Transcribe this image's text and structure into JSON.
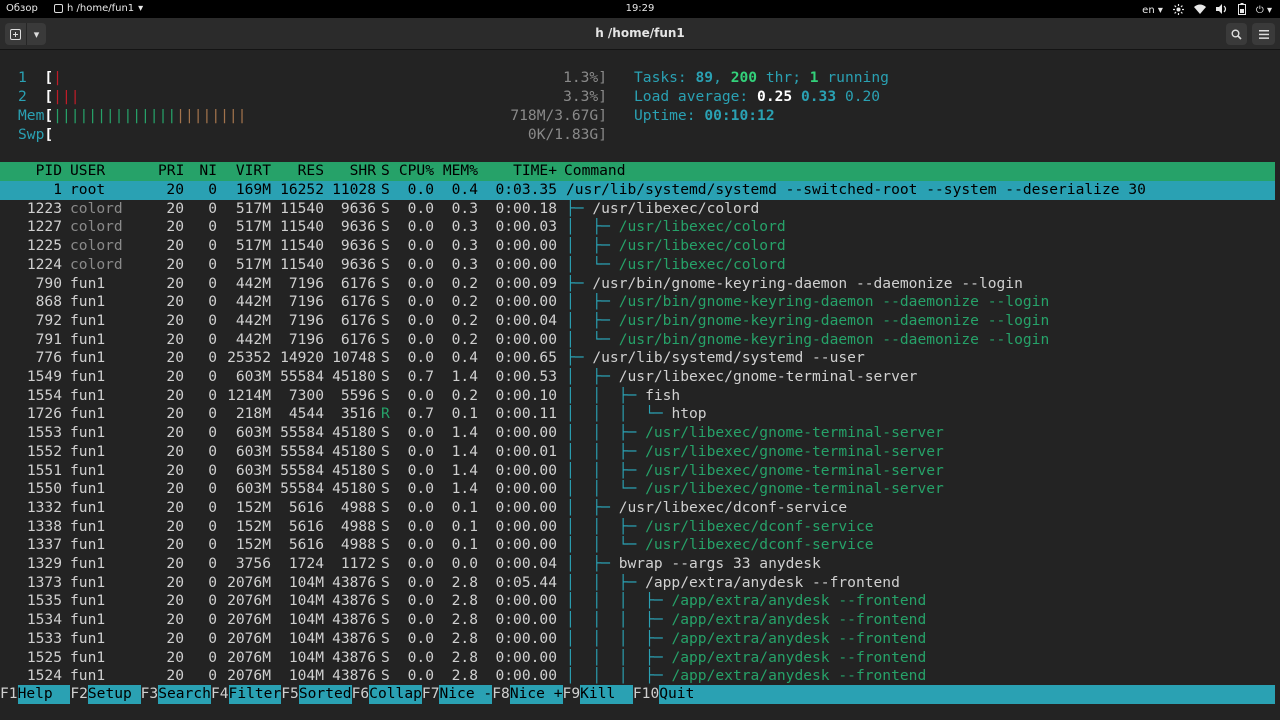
{
  "topbar": {
    "activities": "Обзор",
    "app_name": "h /home/fun1",
    "clock": "19:29",
    "lang": "en"
  },
  "window": {
    "title": "h /home/fun1"
  },
  "meters": {
    "cpu1": {
      "label": "1",
      "bars": "|",
      "value": "1.3%]"
    },
    "cpu2": {
      "label": "2",
      "bars": "|||",
      "value": "3.3%]"
    },
    "mem": {
      "label": "Mem",
      "bars_green": "||||||||||||||",
      "bars_orange": "||||||||",
      "value": "718M/3.67G]"
    },
    "swp": {
      "label": "Swp",
      "value": "0K/1.83G]"
    },
    "tasks": {
      "label": "Tasks:",
      "count": "89",
      "sep1": ",",
      "thr": "200",
      "thr_label": "thr;",
      "running": "1",
      "running_label": "running"
    },
    "load": {
      "label": "Load average:",
      "v1": "0.25",
      "v2": "0.33",
      "v3": "0.20"
    },
    "uptime": {
      "label": "Uptime:",
      "value": "00:10:12"
    }
  },
  "columns": [
    "PID",
    "USER",
    "PRI",
    "NI",
    "VIRT",
    "RES",
    "SHR",
    "S",
    "CPU%",
    "MEM%",
    "TIME+",
    "Command"
  ],
  "processes": [
    {
      "pid": "1",
      "user": "root",
      "pri": "20",
      "ni": "0",
      "virt": "169M",
      "res": "16252",
      "shr": "11028",
      "s": "S",
      "cpu": "0.0",
      "mem": "0.4",
      "time": "0:03.35",
      "tree": "",
      "cmd": "/usr/lib/systemd/systemd --switched-root --system --deserialize 30",
      "thread": false,
      "selected": true
    },
    {
      "pid": "1223",
      "user": "colord",
      "pri": "20",
      "ni": "0",
      "virt": "517M",
      "res": "11540",
      "shr": "9636",
      "s": "S",
      "cpu": "0.0",
      "mem": "0.3",
      "time": "0:00.18",
      "tree": "├─ ",
      "cmd": "/usr/libexec/colord",
      "thread": false
    },
    {
      "pid": "1227",
      "user": "colord",
      "pri": "20",
      "ni": "0",
      "virt": "517M",
      "res": "11540",
      "shr": "9636",
      "s": "S",
      "cpu": "0.0",
      "mem": "0.3",
      "time": "0:00.03",
      "tree": "│  ├─ ",
      "cmd": "/usr/libexec/colord",
      "thread": true
    },
    {
      "pid": "1225",
      "user": "colord",
      "pri": "20",
      "ni": "0",
      "virt": "517M",
      "res": "11540",
      "shr": "9636",
      "s": "S",
      "cpu": "0.0",
      "mem": "0.3",
      "time": "0:00.00",
      "tree": "│  ├─ ",
      "cmd": "/usr/libexec/colord",
      "thread": true
    },
    {
      "pid": "1224",
      "user": "colord",
      "pri": "20",
      "ni": "0",
      "virt": "517M",
      "res": "11540",
      "shr": "9636",
      "s": "S",
      "cpu": "0.0",
      "mem": "0.3",
      "time": "0:00.00",
      "tree": "│  └─ ",
      "cmd": "/usr/libexec/colord",
      "thread": true
    },
    {
      "pid": "790",
      "user": "fun1",
      "pri": "20",
      "ni": "0",
      "virt": "442M",
      "res": "7196",
      "shr": "6176",
      "s": "S",
      "cpu": "0.0",
      "mem": "0.2",
      "time": "0:00.09",
      "tree": "├─ ",
      "cmd": "/usr/bin/gnome-keyring-daemon --daemonize --login",
      "thread": false
    },
    {
      "pid": "868",
      "user": "fun1",
      "pri": "20",
      "ni": "0",
      "virt": "442M",
      "res": "7196",
      "shr": "6176",
      "s": "S",
      "cpu": "0.0",
      "mem": "0.2",
      "time": "0:00.00",
      "tree": "│  ├─ ",
      "cmd": "/usr/bin/gnome-keyring-daemon --daemonize --login",
      "thread": true
    },
    {
      "pid": "792",
      "user": "fun1",
      "pri": "20",
      "ni": "0",
      "virt": "442M",
      "res": "7196",
      "shr": "6176",
      "s": "S",
      "cpu": "0.0",
      "mem": "0.2",
      "time": "0:00.04",
      "tree": "│  ├─ ",
      "cmd": "/usr/bin/gnome-keyring-daemon --daemonize --login",
      "thread": true
    },
    {
      "pid": "791",
      "user": "fun1",
      "pri": "20",
      "ni": "0",
      "virt": "442M",
      "res": "7196",
      "shr": "6176",
      "s": "S",
      "cpu": "0.0",
      "mem": "0.2",
      "time": "0:00.00",
      "tree": "│  └─ ",
      "cmd": "/usr/bin/gnome-keyring-daemon --daemonize --login",
      "thread": true
    },
    {
      "pid": "776",
      "user": "fun1",
      "pri": "20",
      "ni": "0",
      "virt": "25352",
      "res": "14920",
      "shr": "10748",
      "s": "S",
      "cpu": "0.0",
      "mem": "0.4",
      "time": "0:00.65",
      "tree": "├─ ",
      "cmd": "/usr/lib/systemd/systemd --user",
      "thread": false
    },
    {
      "pid": "1549",
      "user": "fun1",
      "pri": "20",
      "ni": "0",
      "virt": "603M",
      "res": "55584",
      "shr": "45180",
      "s": "S",
      "cpu": "0.7",
      "mem": "1.4",
      "time": "0:00.53",
      "tree": "│  ├─ ",
      "cmd": "/usr/libexec/gnome-terminal-server",
      "thread": false
    },
    {
      "pid": "1554",
      "user": "fun1",
      "pri": "20",
      "ni": "0",
      "virt": "1214M",
      "res": "7300",
      "shr": "5596",
      "s": "S",
      "cpu": "0.0",
      "mem": "0.2",
      "time": "0:00.10",
      "tree": "│  │  ├─ ",
      "cmd": "fish",
      "thread": false
    },
    {
      "pid": "1726",
      "user": "fun1",
      "pri": "20",
      "ni": "0",
      "virt": "218M",
      "res": "4544",
      "shr": "3516",
      "s": "R",
      "cpu": "0.7",
      "mem": "0.1",
      "time": "0:00.11",
      "tree": "│  │  │  └─ ",
      "cmd": "htop",
      "thread": false
    },
    {
      "pid": "1553",
      "user": "fun1",
      "pri": "20",
      "ni": "0",
      "virt": "603M",
      "res": "55584",
      "shr": "45180",
      "s": "S",
      "cpu": "0.0",
      "mem": "1.4",
      "time": "0:00.00",
      "tree": "│  │  ├─ ",
      "cmd": "/usr/libexec/gnome-terminal-server",
      "thread": true
    },
    {
      "pid": "1552",
      "user": "fun1",
      "pri": "20",
      "ni": "0",
      "virt": "603M",
      "res": "55584",
      "shr": "45180",
      "s": "S",
      "cpu": "0.0",
      "mem": "1.4",
      "time": "0:00.01",
      "tree": "│  │  ├─ ",
      "cmd": "/usr/libexec/gnome-terminal-server",
      "thread": true
    },
    {
      "pid": "1551",
      "user": "fun1",
      "pri": "20",
      "ni": "0",
      "virt": "603M",
      "res": "55584",
      "shr": "45180",
      "s": "S",
      "cpu": "0.0",
      "mem": "1.4",
      "time": "0:00.00",
      "tree": "│  │  ├─ ",
      "cmd": "/usr/libexec/gnome-terminal-server",
      "thread": true
    },
    {
      "pid": "1550",
      "user": "fun1",
      "pri": "20",
      "ni": "0",
      "virt": "603M",
      "res": "55584",
      "shr": "45180",
      "s": "S",
      "cpu": "0.0",
      "mem": "1.4",
      "time": "0:00.00",
      "tree": "│  │  └─ ",
      "cmd": "/usr/libexec/gnome-terminal-server",
      "thread": true
    },
    {
      "pid": "1332",
      "user": "fun1",
      "pri": "20",
      "ni": "0",
      "virt": "152M",
      "res": "5616",
      "shr": "4988",
      "s": "S",
      "cpu": "0.0",
      "mem": "0.1",
      "time": "0:00.00",
      "tree": "│  ├─ ",
      "cmd": "/usr/libexec/dconf-service",
      "thread": false
    },
    {
      "pid": "1338",
      "user": "fun1",
      "pri": "20",
      "ni": "0",
      "virt": "152M",
      "res": "5616",
      "shr": "4988",
      "s": "S",
      "cpu": "0.0",
      "mem": "0.1",
      "time": "0:00.00",
      "tree": "│  │  ├─ ",
      "cmd": "/usr/libexec/dconf-service",
      "thread": true
    },
    {
      "pid": "1337",
      "user": "fun1",
      "pri": "20",
      "ni": "0",
      "virt": "152M",
      "res": "5616",
      "shr": "4988",
      "s": "S",
      "cpu": "0.0",
      "mem": "0.1",
      "time": "0:00.00",
      "tree": "│  │  └─ ",
      "cmd": "/usr/libexec/dconf-service",
      "thread": true
    },
    {
      "pid": "1329",
      "user": "fun1",
      "pri": "20",
      "ni": "0",
      "virt": "3756",
      "res": "1724",
      "shr": "1172",
      "s": "S",
      "cpu": "0.0",
      "mem": "0.0",
      "time": "0:00.04",
      "tree": "│  ├─ ",
      "cmd": "bwrap --args 33 anydesk",
      "thread": false
    },
    {
      "pid": "1373",
      "user": "fun1",
      "pri": "20",
      "ni": "0",
      "virt": "2076M",
      "res": "104M",
      "shr": "43876",
      "s": "S",
      "cpu": "0.0",
      "mem": "2.8",
      "time": "0:05.44",
      "tree": "│  │  ├─ ",
      "cmd": "/app/extra/anydesk --frontend",
      "thread": false
    },
    {
      "pid": "1535",
      "user": "fun1",
      "pri": "20",
      "ni": "0",
      "virt": "2076M",
      "res": "104M",
      "shr": "43876",
      "s": "S",
      "cpu": "0.0",
      "mem": "2.8",
      "time": "0:00.00",
      "tree": "│  │  │  ├─ ",
      "cmd": "/app/extra/anydesk --frontend",
      "thread": true
    },
    {
      "pid": "1534",
      "user": "fun1",
      "pri": "20",
      "ni": "0",
      "virt": "2076M",
      "res": "104M",
      "shr": "43876",
      "s": "S",
      "cpu": "0.0",
      "mem": "2.8",
      "time": "0:00.00",
      "tree": "│  │  │  ├─ ",
      "cmd": "/app/extra/anydesk --frontend",
      "thread": true
    },
    {
      "pid": "1533",
      "user": "fun1",
      "pri": "20",
      "ni": "0",
      "virt": "2076M",
      "res": "104M",
      "shr": "43876",
      "s": "S",
      "cpu": "0.0",
      "mem": "2.8",
      "time": "0:00.00",
      "tree": "│  │  │  ├─ ",
      "cmd": "/app/extra/anydesk --frontend",
      "thread": true
    },
    {
      "pid": "1525",
      "user": "fun1",
      "pri": "20",
      "ni": "0",
      "virt": "2076M",
      "res": "104M",
      "shr": "43876",
      "s": "S",
      "cpu": "0.0",
      "mem": "2.8",
      "time": "0:00.00",
      "tree": "│  │  │  ├─ ",
      "cmd": "/app/extra/anydesk --frontend",
      "thread": true
    },
    {
      "pid": "1524",
      "user": "fun1",
      "pri": "20",
      "ni": "0",
      "virt": "2076M",
      "res": "104M",
      "shr": "43876",
      "s": "S",
      "cpu": "0.0",
      "mem": "2.8",
      "time": "0:00.00",
      "tree": "│  │  │  ├─ ",
      "cmd": "/app/extra/anydesk --frontend",
      "thread": true
    }
  ],
  "function_keys": [
    {
      "key": "F1",
      "label": "Help"
    },
    {
      "key": "F2",
      "label": "Setup"
    },
    {
      "key": "F3",
      "label": "Search"
    },
    {
      "key": "F4",
      "label": "Filter"
    },
    {
      "key": "F5",
      "label": "Sorted"
    },
    {
      "key": "F6",
      "label": "Collap"
    },
    {
      "key": "F7",
      "label": "Nice -"
    },
    {
      "key": "F8",
      "label": "Nice +"
    },
    {
      "key": "F9",
      "label": "Kill"
    },
    {
      "key": "F10",
      "label": "Quit"
    }
  ],
  "colors": {
    "accent": "#2aa1b3",
    "header_bg": "#26a269",
    "thread_green": "#26a269",
    "terminal_bg": "#232323"
  },
  "icons": {
    "topbar": [
      "network-icon",
      "wifi-icon",
      "volume-icon",
      "battery-icon",
      "power-icon"
    ],
    "headerbar": [
      "new-tab-icon",
      "chevron-down-icon",
      "search-icon",
      "hamburger-menu-icon"
    ]
  }
}
